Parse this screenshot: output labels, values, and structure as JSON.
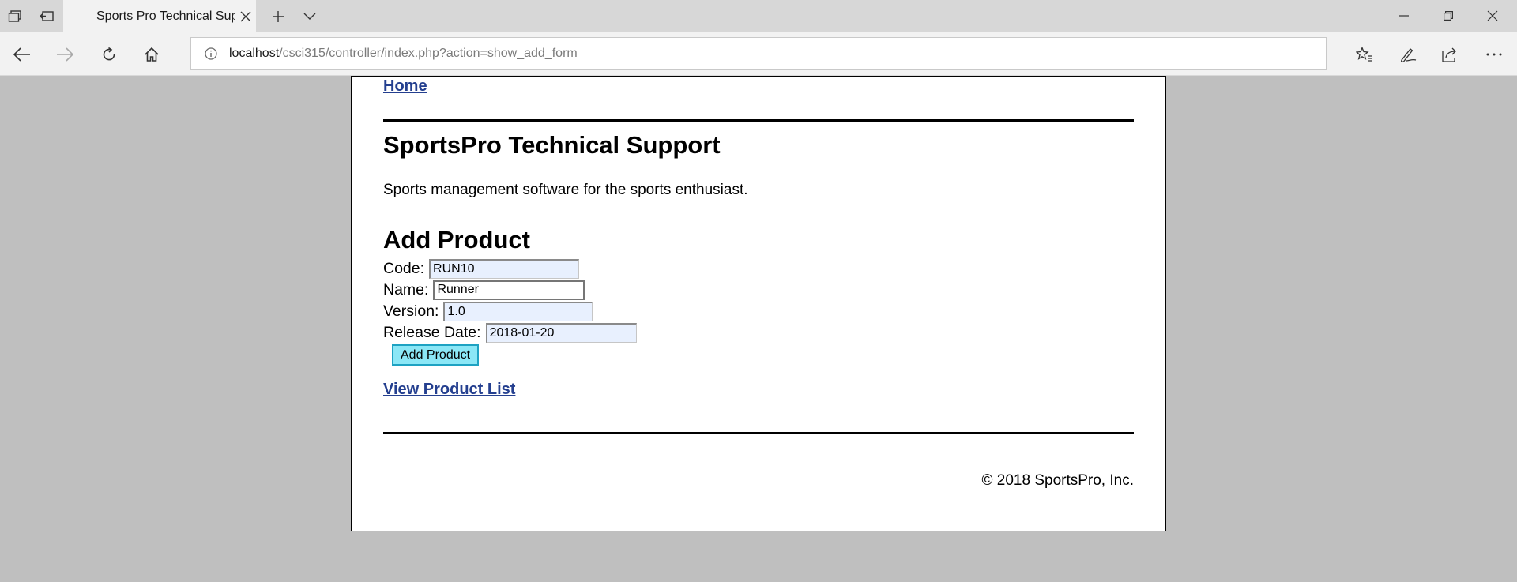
{
  "browser": {
    "tab_title": "Sports Pro Technical Support",
    "url_host": "localhost",
    "url_path": "/csci315/controller/index.php?action=show_add_form"
  },
  "page": {
    "home_link": "Home",
    "title": "SportsPro Technical Support",
    "tagline": "Sports management software for the sports enthusiast.",
    "form_heading": "Add Product",
    "fields": {
      "code": {
        "label": "Code:",
        "value": "RUN10"
      },
      "name": {
        "label": "Name:",
        "value": "Runner"
      },
      "version": {
        "label": "Version:",
        "value": "1.0"
      },
      "release_date": {
        "label": "Release Date:",
        "value": "2018-01-20"
      }
    },
    "submit_label": "Add Product",
    "view_list_link": "View Product List",
    "footer": "© 2018 SportsPro, Inc."
  },
  "colors": {
    "link": "#243f8f",
    "button_bg": "#8be7f6",
    "button_border": "#1ea2c2",
    "page_bg": "#bfbfbf"
  }
}
